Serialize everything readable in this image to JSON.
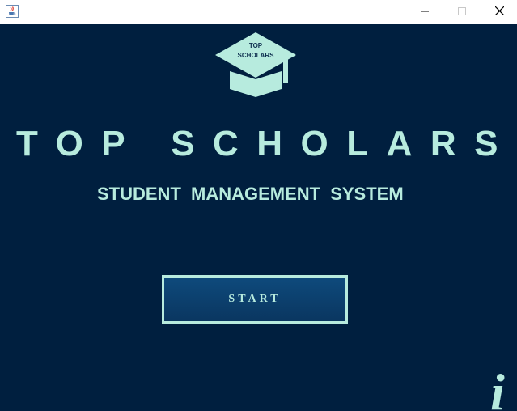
{
  "window": {
    "app_icon": "java-cup-icon",
    "controls": [
      "minimize-icon",
      "maximize-icon",
      "close-icon"
    ]
  },
  "logo": {
    "icon": "graduation-cap-icon",
    "line1": "TOP",
    "line2": "SCHOLARS"
  },
  "main": {
    "title": "TOP SCHOLARS",
    "subtitle": "STUDENT MANAGEMENT SYSTEM",
    "start_label": "START",
    "info_symbol": "i"
  },
  "colors": {
    "background": "#001f3f",
    "accent": "#b7ebde",
    "button": "#0b3d6b"
  }
}
